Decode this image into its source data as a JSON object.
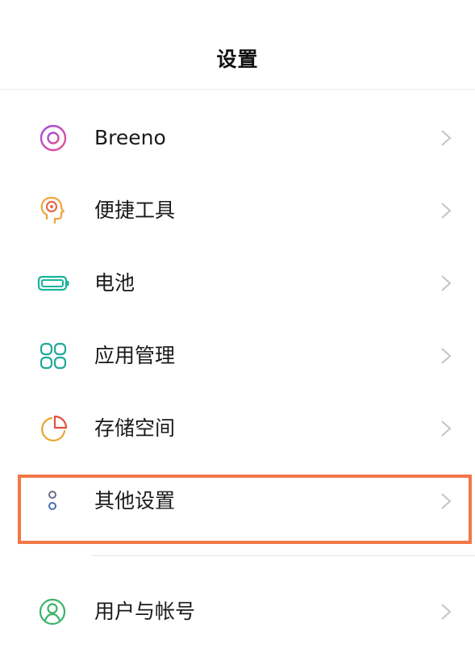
{
  "header": {
    "title": "设置"
  },
  "menu": [
    {
      "label": "Breeno",
      "icon": "breeno-icon",
      "icon_color": "#b24fd9"
    },
    {
      "label": "便捷工具",
      "icon": "convenience-tools-icon",
      "icon_color": "#f0a33a"
    },
    {
      "label": "电池",
      "icon": "battery-icon",
      "icon_color": "#1ab39b"
    },
    {
      "label": "应用管理",
      "icon": "app-management-icon",
      "icon_color": "#21a99a"
    },
    {
      "label": "存储空间",
      "icon": "storage-icon",
      "icon_color": "#e7a52a"
    },
    {
      "label": "其他设置",
      "icon": "other-settings-icon",
      "icon_color": "#6b6e8a",
      "highlighted": true
    },
    {
      "label": "用户与帐号",
      "icon": "user-account-icon",
      "icon_color": "#3db36b"
    }
  ],
  "colors": {
    "highlight_border": "#f37747",
    "chevron": "#c4c4c4"
  }
}
